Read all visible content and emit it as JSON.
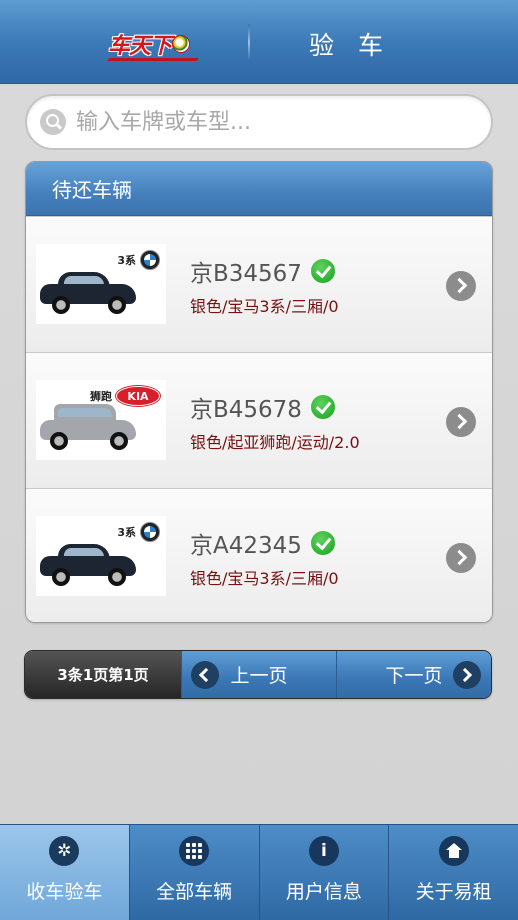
{
  "header": {
    "logo_text": "车天下",
    "title": "验 车"
  },
  "search": {
    "placeholder": "输入车牌或车型..."
  },
  "panel": {
    "title": "待还车辆",
    "cars": [
      {
        "plate": "京B34567",
        "description": "银色/宝马3系/三厢/0",
        "model_tag": "3系",
        "brand": "BMW"
      },
      {
        "plate": "京B45678",
        "description": "银色/起亚狮跑/运动/2.0",
        "model_tag": "狮跑",
        "brand": "KIA"
      },
      {
        "plate": "京A42345",
        "description": "银色/宝马3系/三厢/0",
        "model_tag": "3系",
        "brand": "BMW"
      }
    ]
  },
  "pager": {
    "info": "3条1页第1页",
    "prev_label": "上一页",
    "next_label": "下一页"
  },
  "tabbar": {
    "tabs": [
      {
        "label": "收车验车",
        "icon": "gear-icon",
        "active": true
      },
      {
        "label": "全部车辆",
        "icon": "grid-icon",
        "active": false
      },
      {
        "label": "用户信息",
        "icon": "info-icon",
        "active": false
      },
      {
        "label": "关于易租",
        "icon": "home-icon",
        "active": false
      }
    ]
  },
  "colors": {
    "header_blue": "#3a78b6",
    "desc_red": "#7a1010",
    "check_green": "#16a11f"
  }
}
